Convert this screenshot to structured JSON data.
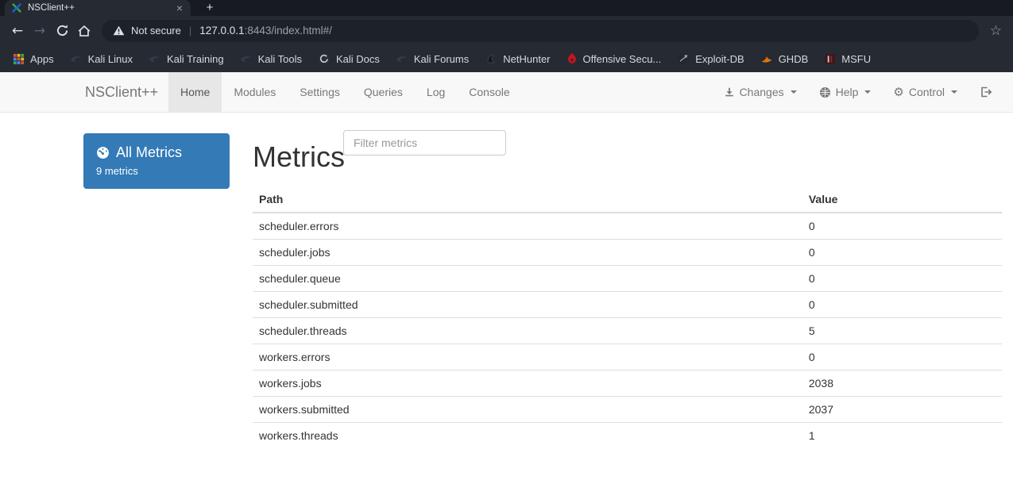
{
  "browser": {
    "tab_title": "NSClient++",
    "close_tab_glyph": "×",
    "new_tab_glyph": "+",
    "back_glyph": "←",
    "forward_glyph": "→",
    "star_glyph": "☆",
    "address": {
      "security_label": "Not secure",
      "separator": "|",
      "host": "127.0.0.1",
      "path": ":8443/index.html#/"
    },
    "bookmarks": [
      {
        "label": "Apps",
        "icon": "apps-grid-icon"
      },
      {
        "label": "Kali Linux",
        "icon": "kali-dragon-icon"
      },
      {
        "label": "Kali Training",
        "icon": "kali-dragon-icon"
      },
      {
        "label": "Kali Tools",
        "icon": "kali-dragon-icon"
      },
      {
        "label": "Kali Docs",
        "icon": "kali-docs-icon"
      },
      {
        "label": "Kali Forums",
        "icon": "kali-dragon-icon"
      },
      {
        "label": "NetHunter",
        "icon": "nethunter-icon"
      },
      {
        "label": "Offensive Secu...",
        "icon": "offensive-security-icon"
      },
      {
        "label": "Exploit-DB",
        "icon": "exploit-db-icon"
      },
      {
        "label": "GHDB",
        "icon": "ghdb-icon"
      },
      {
        "label": "MSFU",
        "icon": "msfu-icon"
      }
    ]
  },
  "app": {
    "brand": "NSClient++",
    "nav_items": [
      {
        "label": "Home"
      },
      {
        "label": "Modules"
      },
      {
        "label": "Settings"
      },
      {
        "label": "Queries"
      },
      {
        "label": "Log"
      },
      {
        "label": "Console"
      }
    ],
    "active_nav": "Home",
    "nav_right": [
      {
        "label": "Changes",
        "icon": "download-icon"
      },
      {
        "label": "Help",
        "icon": "globe-icon"
      },
      {
        "label": "Control",
        "icon": "gear-icon"
      }
    ],
    "gear_glyph": "⚙"
  },
  "sidebar": {
    "all_metrics_label": "All Metrics",
    "metrics_count": "9 metrics",
    "icon": "dashboard-gauge-icon"
  },
  "metrics": {
    "heading": "Metrics",
    "filter_placeholder": "Filter metrics",
    "columns": {
      "path": "Path",
      "value": "Value"
    },
    "rows": [
      {
        "path": "scheduler.errors",
        "value": "0"
      },
      {
        "path": "scheduler.jobs",
        "value": "0"
      },
      {
        "path": "scheduler.queue",
        "value": "0"
      },
      {
        "path": "scheduler.submitted",
        "value": "0"
      },
      {
        "path": "scheduler.threads",
        "value": "5"
      },
      {
        "path": "workers.errors",
        "value": "0"
      },
      {
        "path": "workers.jobs",
        "value": "2038"
      },
      {
        "path": "workers.submitted",
        "value": "2037"
      },
      {
        "path": "workers.threads",
        "value": "1"
      }
    ]
  },
  "colors": {
    "accent_blue": "#337ab7",
    "navbar_bg": "#f8f8f8",
    "navbar_border": "#e7e7e7",
    "chrome_dark": "#262b33",
    "chrome_darker": "#171b21",
    "url_field": "#1d222a",
    "table_border": "#dddddd",
    "offsec_red": "#c01722",
    "ghdb_orange": "#e8710a"
  }
}
